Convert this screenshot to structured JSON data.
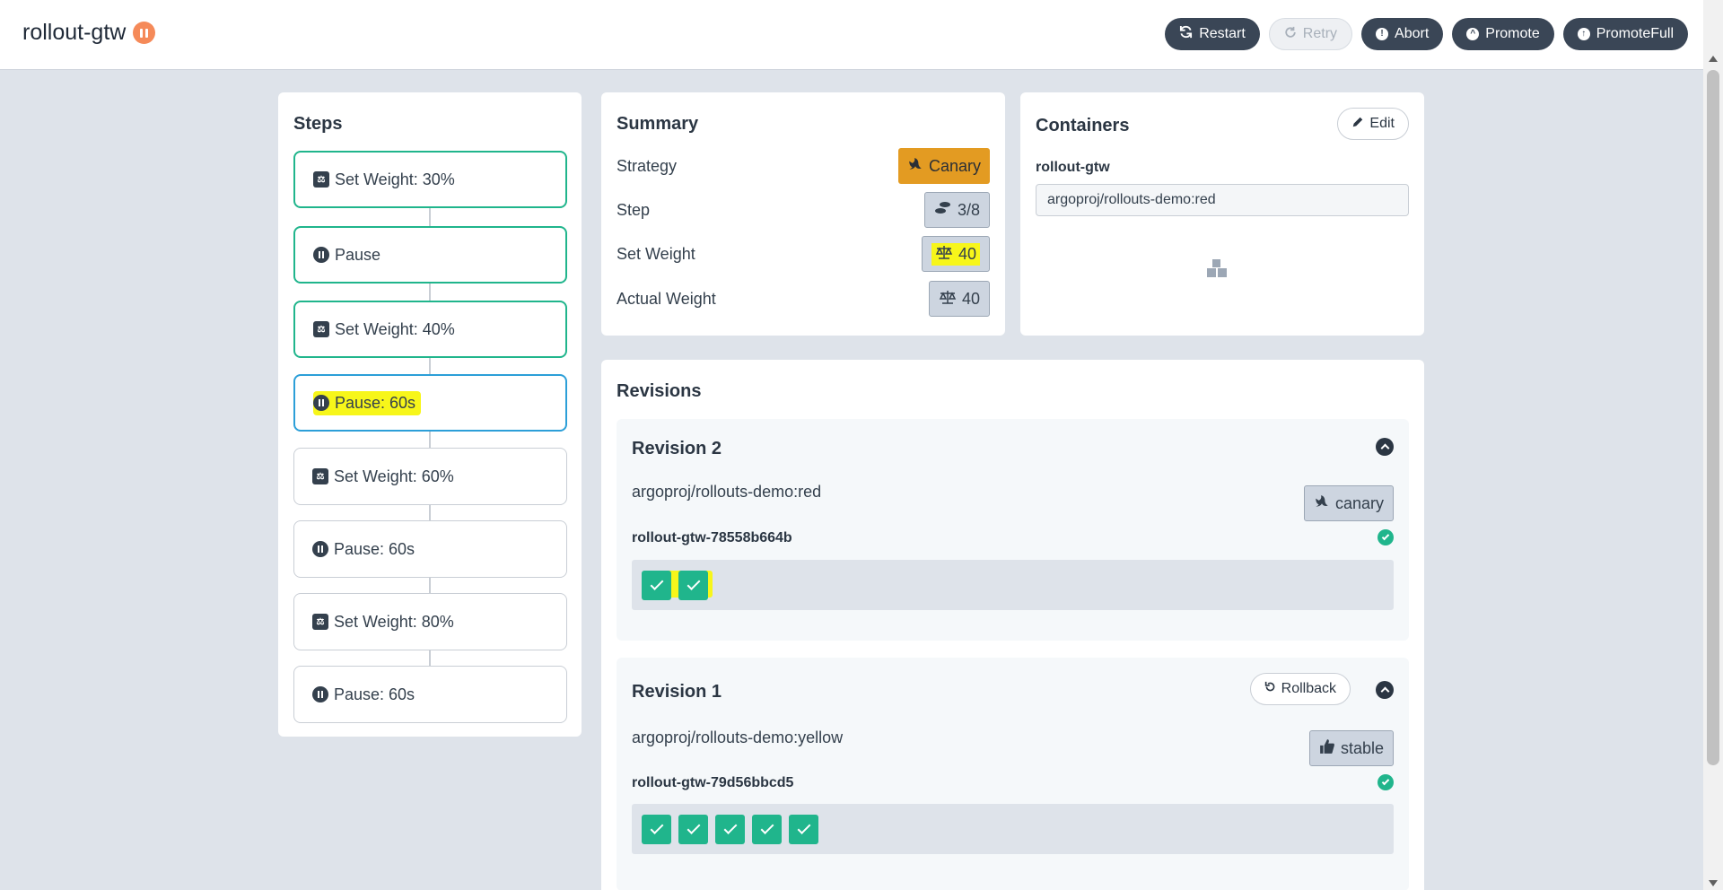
{
  "header": {
    "title": "rollout-gtw",
    "actions": {
      "restart": "Restart",
      "retry": "Retry",
      "abort": "Abort",
      "promote": "Promote",
      "promote_full": "PromoteFull"
    }
  },
  "steps": {
    "title": "Steps",
    "items": [
      {
        "label": "Set Weight: 30%",
        "icon": "scale-icon",
        "state": "completed"
      },
      {
        "label": "Pause",
        "icon": "pause-icon",
        "state": "completed"
      },
      {
        "label": "Set Weight: 40%",
        "icon": "scale-icon",
        "state": "completed"
      },
      {
        "label": "Pause: 60s",
        "icon": "pause-icon",
        "state": "current"
      },
      {
        "label": "Set Weight: 60%",
        "icon": "scale-icon",
        "state": "pending"
      },
      {
        "label": "Pause: 60s",
        "icon": "pause-icon",
        "state": "pending"
      },
      {
        "label": "Set Weight: 80%",
        "icon": "scale-icon",
        "state": "pending"
      },
      {
        "label": "Pause: 60s",
        "icon": "pause-icon",
        "state": "pending"
      }
    ]
  },
  "summary": {
    "title": "Summary",
    "strategy_label": "Strategy",
    "strategy_value": "Canary",
    "step_label": "Step",
    "step_value": "3/8",
    "set_weight_label": "Set Weight",
    "set_weight_value": "40",
    "actual_weight_label": "Actual Weight",
    "actual_weight_value": "40"
  },
  "containers": {
    "title": "Containers",
    "edit_label": "Edit",
    "name": "rollout-gtw",
    "image": "argoproj/rollouts-demo:red"
  },
  "revisions": {
    "title": "Revisions",
    "items": [
      {
        "title": "Revision 2",
        "image": "argoproj/rollouts-demo:red",
        "badge": "canary",
        "replicaset": "rollout-gtw-78558b664b",
        "pods": 2
      },
      {
        "title": "Revision 1",
        "rollback_label": "Rollback",
        "image": "argoproj/rollouts-demo:yellow",
        "badge": "stable",
        "replicaset": "rollout-gtw-79d56bbcd5",
        "pods": 5
      }
    ]
  },
  "colors": {
    "completed": "#20b58c",
    "current": "#2c9fd8",
    "canary": "#e39b22",
    "highlight": "#f7f61a",
    "status_paused": "#f58a59"
  }
}
